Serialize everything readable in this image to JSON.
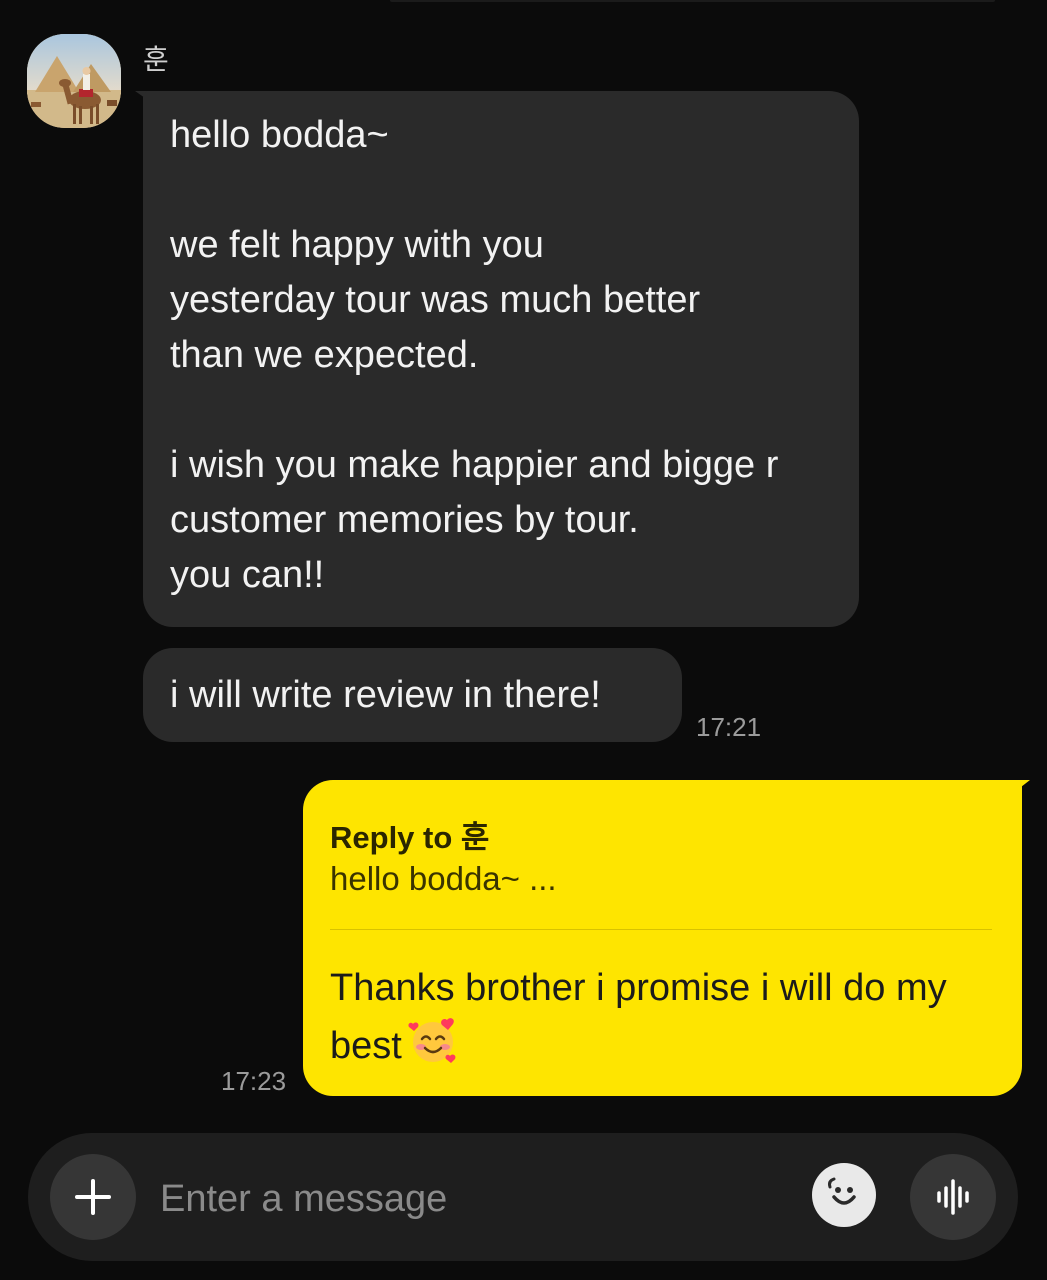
{
  "conversation": {
    "contact_name": "훈",
    "messages_in": [
      {
        "text": "hello bodda~\n\nwe felt happy with you\nyesterday tour was much better\nthan we expected.\n\ni wish you make happier and bigge r\ncustomer memories by tour.\nyou can!!"
      },
      {
        "text": "i will write review in there!",
        "time": "17:21"
      }
    ],
    "message_out": {
      "reply_title": "Reply to 훈",
      "reply_quote": "hello bodda~ ...",
      "text": "Thanks brother i promise i will do my best",
      "emoji": "smiling-face-with-hearts-icon",
      "time": "17:23"
    }
  },
  "composer": {
    "placeholder": "Enter a message",
    "add_icon": "plus-icon",
    "emoji_icon": "emoji-icon",
    "voice_icon": "voice-wave-icon"
  },
  "colors": {
    "background": "#0b0b0b",
    "incoming_bubble": "#2a2a2a",
    "outgoing_bubble": "#fee500",
    "timestamp": "#9b9b9b"
  }
}
